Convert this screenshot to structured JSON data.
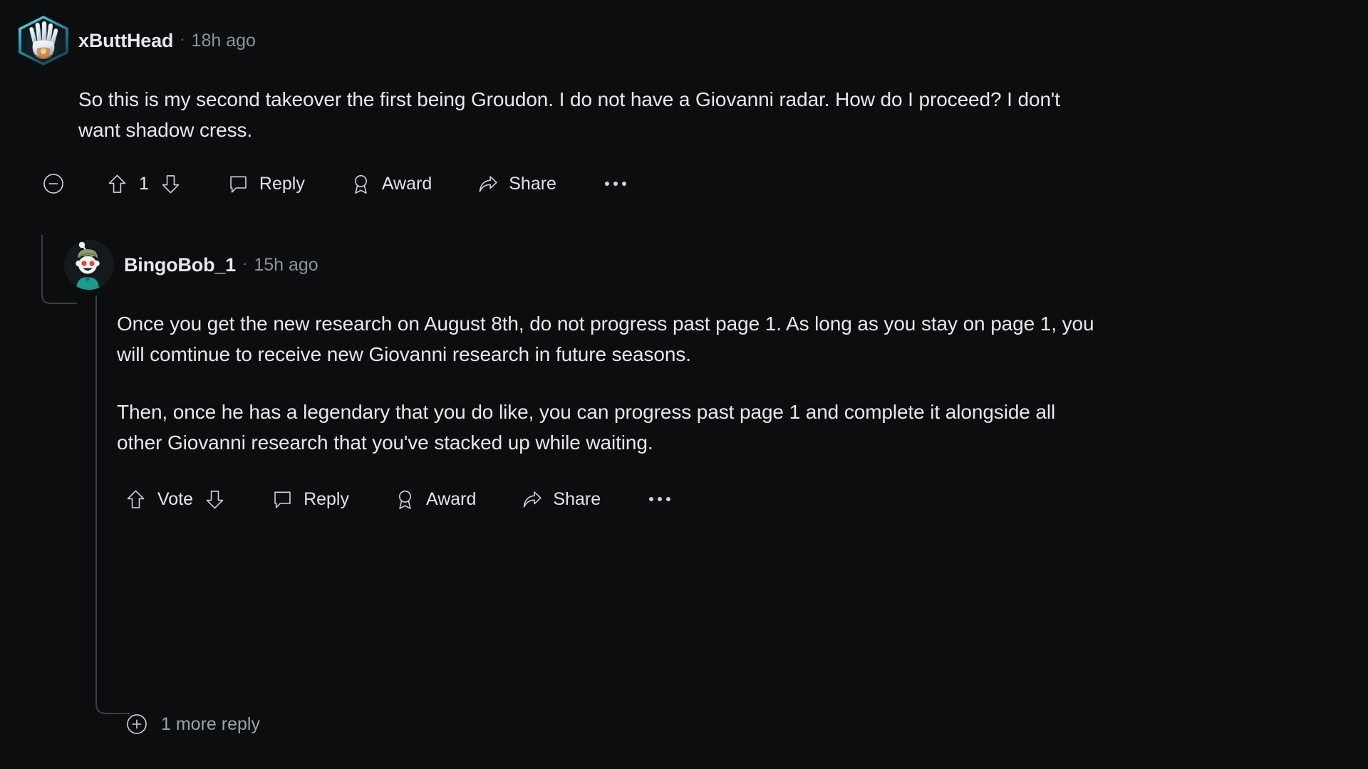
{
  "theme": {
    "background": "#0b0d0e",
    "text_primary": "#e6e8eb",
    "text_muted": "#8c949c",
    "thread_line": "#3a4045",
    "icon": "#cfd4d8"
  },
  "comments": [
    {
      "id": "c1",
      "author": "xButtHead",
      "timestamp": "18h ago",
      "meta_separator": "·",
      "avatar": {
        "type": "hexagon-badge",
        "icon_name": "hand-badge-avatar",
        "border_color": "#2a9fb5",
        "background_color": "#0f1f26"
      },
      "paragraphs": [
        "So this is my second takeover the first being Groudon. I do not have a Giovanni radar. How do I proceed? I don't want shadow cress."
      ],
      "actions": {
        "collapse": {
          "icon": "collapse-minus-icon",
          "label": ""
        },
        "upvote": {
          "icon": "upvote-arrow-icon",
          "label": ""
        },
        "score": "1",
        "downvote": {
          "icon": "downvote-arrow-icon",
          "label": ""
        },
        "reply": {
          "icon": "comment-bubble-icon",
          "label": "Reply"
        },
        "award": {
          "icon": "award-ribbon-icon",
          "label": "Award"
        },
        "share": {
          "icon": "share-arrow-icon",
          "label": "Share"
        },
        "overflow": {
          "icon": "overflow-dots-icon",
          "label": ""
        }
      }
    },
    {
      "id": "c2",
      "author": "BingoBob_1",
      "timestamp": "15h ago",
      "meta_separator": "·",
      "avatar": {
        "type": "snoo",
        "icon_name": "snoo-avatar",
        "hat_color": "#8d9b6a",
        "shirt_color": "#1b9a92",
        "face_color": "#f2f2f2",
        "eye_color": "#e2453c"
      },
      "paragraphs": [
        "Once you get the new research on August 8th, do not progress past page 1. As long as you stay on page 1, you will comtinue to receive new Giovanni research in future seasons.",
        "Then, once he has a legendary that you do like, you can progress past page 1 and complete it alongside all other Giovanni research that you've stacked up while waiting."
      ],
      "actions": {
        "upvote": {
          "icon": "upvote-arrow-icon",
          "label": ""
        },
        "score": "Vote",
        "downvote": {
          "icon": "downvote-arrow-icon",
          "label": ""
        },
        "reply": {
          "icon": "comment-bubble-icon",
          "label": "Reply"
        },
        "award": {
          "icon": "award-ribbon-icon",
          "label": "Award"
        },
        "share": {
          "icon": "share-arrow-icon",
          "label": "Share"
        },
        "overflow": {
          "icon": "overflow-dots-icon",
          "label": ""
        }
      }
    }
  ],
  "more_replies": {
    "icon": "expand-plus-icon",
    "label": "1 more reply"
  }
}
